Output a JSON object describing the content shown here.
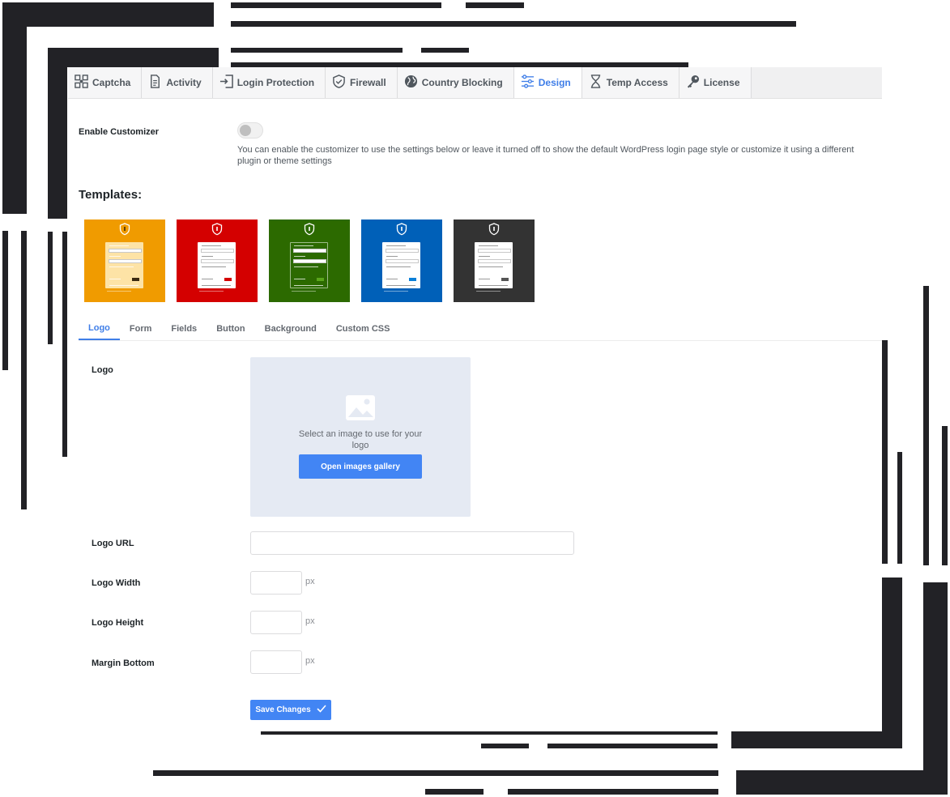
{
  "tabs": [
    {
      "label": "Captcha",
      "icon": "captcha-icon",
      "active": false
    },
    {
      "label": "Activity",
      "icon": "document-icon",
      "active": false
    },
    {
      "label": "Login Protection",
      "icon": "login-door-icon",
      "active": false
    },
    {
      "label": "Firewall",
      "icon": "shield-check-icon",
      "active": false
    },
    {
      "label": "Country Blocking",
      "icon": "globe-icon",
      "active": false
    },
    {
      "label": "Design",
      "icon": "sliders-icon",
      "active": true
    },
    {
      "label": "Temp Access",
      "icon": "hourglass-icon",
      "active": false
    },
    {
      "label": "License",
      "icon": "key-icon",
      "active": false
    }
  ],
  "customizer": {
    "label": "Enable Customizer",
    "enabled": false,
    "description": "You can enable the customizer to use the settings below or leave it turned off to show the default WordPress login page style or customize it using a different plugin or theme settings"
  },
  "templates": {
    "title": "Templates:",
    "items": [
      {
        "name": "yellow",
        "bg": "#f09b00",
        "form": "#fde3a6",
        "button": "#3b2a12"
      },
      {
        "name": "red",
        "bg": "#d40000",
        "form": "#ffffff",
        "button": "#d40000"
      },
      {
        "name": "green",
        "bg": "#2c6a00",
        "form": "#2c6a00",
        "button": "#5aa51c"
      },
      {
        "name": "blue",
        "bg": "#0060b8",
        "form": "#ffffff",
        "button": "#0a7fd8"
      },
      {
        "name": "dark",
        "bg": "#333333",
        "form": "#ffffff",
        "button": "#555555"
      }
    ]
  },
  "subtabs": [
    {
      "label": "Logo",
      "active": true
    },
    {
      "label": "Form",
      "active": false
    },
    {
      "label": "Fields",
      "active": false
    },
    {
      "label": "Button",
      "active": false
    },
    {
      "label": "Background",
      "active": false
    },
    {
      "label": "Custom CSS",
      "active": false
    }
  ],
  "logo": {
    "label": "Logo",
    "gallery_text": "Select an image to use for your logo",
    "gallery_button": "Open images gallery"
  },
  "fields": {
    "logo_url": {
      "label": "Logo URL",
      "value": ""
    },
    "logo_width": {
      "label": "Logo Width",
      "value": "",
      "unit": "px"
    },
    "logo_height": {
      "label": "Logo Height",
      "value": "",
      "unit": "px"
    },
    "margin_bottom": {
      "label": "Margin Bottom",
      "value": "",
      "unit": "px"
    }
  },
  "save_button": "Save Changes",
  "colors": {
    "accent": "#3f7ee8",
    "button": "#4285f4",
    "bars": "#222226"
  }
}
